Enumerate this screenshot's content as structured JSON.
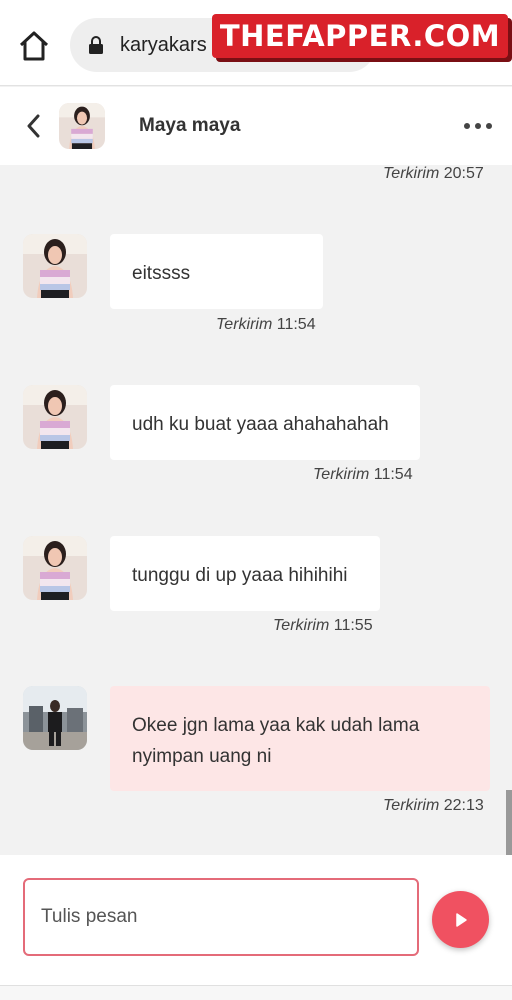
{
  "browser": {
    "url": "karyakars",
    "watermark": "THEFAPPER.COM"
  },
  "header": {
    "contact_name": "Maya maya"
  },
  "messages": [
    {
      "status": "Terkirim",
      "time": "20:57"
    },
    {
      "from": "Maya maya",
      "text": "eitssss",
      "status": "Terkirim",
      "time": "11:54"
    },
    {
      "from": "Maya maya",
      "text": "udh ku buat yaaa ahahahahah",
      "status": "Terkirim",
      "time": "11:54"
    },
    {
      "from": "Maya maya",
      "text": "tunggu di up yaaa hihihihi",
      "status": "Terkirim",
      "time": "11:55"
    },
    {
      "from": "me",
      "text": "Okee jgn lama yaa kak udah lama nyimpan uang ni",
      "status": "Terkirim",
      "time": "22:13"
    }
  ],
  "composer": {
    "placeholder": "Tulis pesan"
  },
  "colors": {
    "accent": "#f05161",
    "input_border": "#e46b79",
    "own_bubble": "#fde6e6",
    "watermark_bg": "#d9212a"
  }
}
